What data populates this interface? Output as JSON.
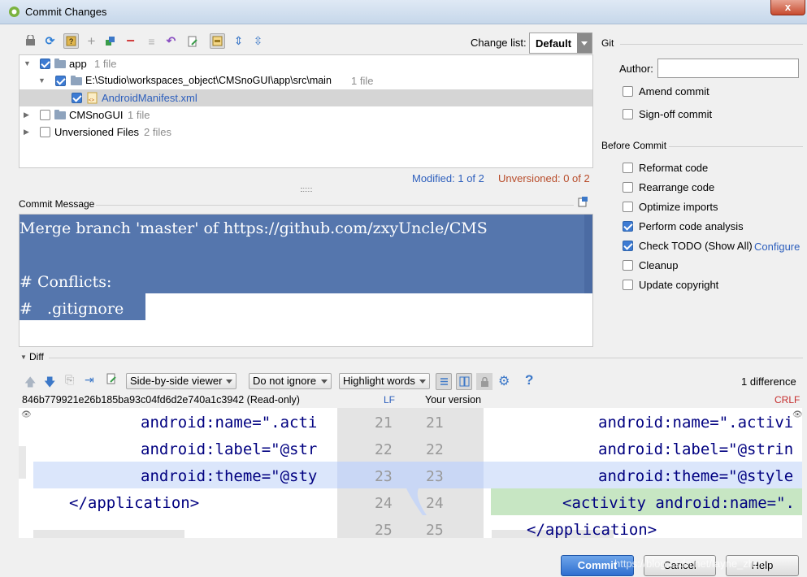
{
  "window": {
    "title": "Commit Changes",
    "close_glyph": "x"
  },
  "changelist": {
    "label": "Change list:",
    "value": "Default"
  },
  "tree": {
    "rows": [
      {
        "name": "app",
        "meta": "1 file"
      },
      {
        "name": "E:\\Studio\\workspaces_object\\CMSnoGUI\\app\\src\\main",
        "meta": "1 file"
      },
      {
        "name": "AndroidManifest.xml",
        "meta": ""
      },
      {
        "name": "CMSnoGUI",
        "meta": "1 file"
      },
      {
        "name": "Unversioned Files",
        "meta": "2 files"
      }
    ]
  },
  "status": {
    "modified": "Modified: 1 of 2",
    "unversioned": "Unversioned: 0 of 2"
  },
  "commit_message": {
    "label": "Commit Message",
    "lines": [
      "Merge branch 'master' of https://github.com/zxyUncle/CMS",
      "",
      "# Conflicts:",
      "#   .gitignore"
    ]
  },
  "git": {
    "header": "Git",
    "author_label": "Author:",
    "author_value": "",
    "amend": "Amend commit",
    "signoff": "Sign-off commit"
  },
  "before_commit": {
    "header": "Before Commit",
    "options": [
      {
        "label": "Reformat code",
        "checked": false
      },
      {
        "label": "Rearrange code",
        "checked": false
      },
      {
        "label": "Optimize imports",
        "checked": false
      },
      {
        "label": "Perform code analysis",
        "checked": true
      },
      {
        "label": "Check TODO (Show All)",
        "checked": true
      },
      {
        "label": "Cleanup",
        "checked": false
      },
      {
        "label": "Update copyright",
        "checked": false
      }
    ],
    "configure_link": "Configure"
  },
  "diff": {
    "header": "Diff",
    "viewer": "Side-by-side viewer",
    "ignore": "Do not ignore",
    "highlight": "Highlight words",
    "count": "1 difference",
    "left_title": "846b779921e26b185ba93c04fd6d2e740a1c3942 (Read-only)",
    "left_le": "LF",
    "right_title": "Your version",
    "right_le": "CRLF",
    "left_lines": [
      "android:name=\".acti",
      "android:label=\"@str",
      "android:theme=\"@sty",
      "</application>",
      ""
    ],
    "left_nums": [
      "21",
      "22",
      "23",
      "24",
      "25"
    ],
    "right_nums": [
      "21",
      "22",
      "23",
      "24",
      "25"
    ],
    "right_lines": [
      "android:name=\".activi",
      "android:label=\"@strin",
      "android:theme=\"@style",
      "<activity android:name=\".",
      "</application>"
    ]
  },
  "buttons": {
    "commit": "Commit",
    "cancel": "Cancel",
    "help": "Help"
  },
  "watermark": "https://blog.csdn.net/layne_zhou",
  "colors": {
    "selection": "#5576ad",
    "accent": "#3d7bd3",
    "link": "#2d5fbd",
    "unversioned": "#b84c2a",
    "inserted": "#c7e6c3",
    "changed": "#dbe6fb"
  }
}
